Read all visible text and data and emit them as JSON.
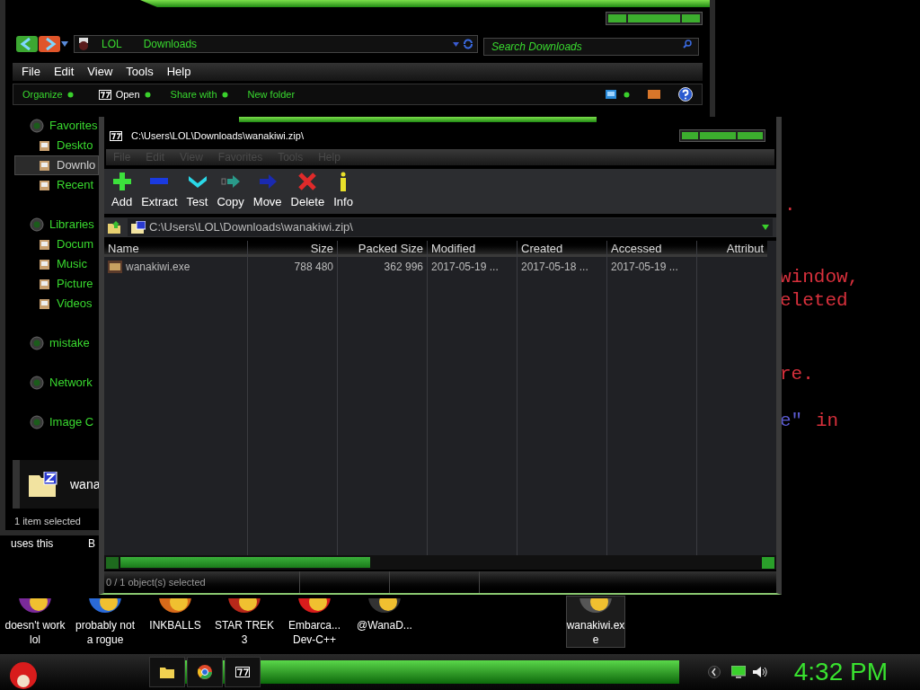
{
  "desktop_text": [
    {
      "text": ".",
      "color": "#d8303c"
    },
    {
      "text": "window,",
      "color": "#d8303c"
    },
    {
      "text": "eleted",
      "color": "#d8303c"
    },
    {
      "text": "re.",
      "color": "#d8303c"
    },
    {
      "text": "e\"",
      "color": "#5a5ad0"
    },
    {
      "text": "in",
      "color": "#d8303c"
    }
  ],
  "explorer": {
    "breadcrumb": [
      "LOL",
      "Downloads"
    ],
    "search": {
      "placeholder": "Search Downloads"
    },
    "menu": [
      "File",
      "Edit",
      "View",
      "Tools",
      "Help"
    ],
    "toolbar": [
      {
        "label": "Organize",
        "kind": "menu"
      },
      {
        "label": "Open",
        "kind": "open"
      },
      {
        "label": "Share with",
        "kind": "menu"
      },
      {
        "label": "New folder",
        "kind": "plain"
      }
    ],
    "sidebar": [
      {
        "label": "Favorites",
        "selected": false,
        "children": [
          {
            "label": "Deskto",
            "selected": false
          },
          {
            "label": "Downlo",
            "selected": true
          },
          {
            "label": "Recent",
            "selected": false
          }
        ]
      },
      {
        "label": "Libraries",
        "selected": false,
        "children": [
          {
            "label": "Docum",
            "selected": false
          },
          {
            "label": "Music",
            "selected": false
          },
          {
            "label": "Picture",
            "selected": false
          },
          {
            "label": "Videos",
            "selected": false
          }
        ]
      },
      {
        "label": "mistake",
        "selected": false
      },
      {
        "label": "Network",
        "selected": false
      },
      {
        "label": "Image C",
        "selected": false
      }
    ],
    "details": {
      "name": "wana"
    },
    "status": "1 item selected"
  },
  "hidden_labels": [
    "uses this",
    "B"
  ],
  "archive": {
    "title": "C:\\Users\\LOL\\Downloads\\wanakiwi.zip\\",
    "menu": [
      "File",
      "Edit",
      "View",
      "Favorites",
      "Tools",
      "Help"
    ],
    "toolbar": [
      {
        "label": "Add",
        "kind": "add"
      },
      {
        "label": "Extract",
        "kind": "extract"
      },
      {
        "label": "Test",
        "kind": "test"
      },
      {
        "label": "Copy",
        "kind": "copy"
      },
      {
        "label": "Move",
        "kind": "move"
      },
      {
        "label": "Delete",
        "kind": "delete"
      },
      {
        "label": "Info",
        "kind": "info"
      }
    ],
    "path": "C:\\Users\\LOL\\Downloads\\wanakiwi.zip\\",
    "table": {
      "columns": [
        "Name",
        "Size",
        "Packed Size",
        "Modified",
        "Created",
        "Accessed",
        "Attribut"
      ],
      "rows": [
        {
          "cells": [
            "wanakiwi.exe",
            "788 480",
            "362 996",
            "2017-05-19 ...",
            "2017-05-18 ...",
            "2017-05-19 ..."
          ]
        }
      ]
    },
    "status": "0 / 1 object(s) selected"
  },
  "desktop_icons": [
    {
      "lines": [
        "doesn't work",
        "lol"
      ],
      "selected": false
    },
    {
      "lines": [
        "probably not",
        "a rogue"
      ],
      "selected": false
    },
    {
      "lines": [
        "INKBALLS"
      ],
      "selected": false
    },
    {
      "lines": [
        "STAR TREK",
        "3"
      ],
      "selected": false
    },
    {
      "lines": [
        "Embarca...",
        "Dev-C++"
      ],
      "selected": false
    },
    {
      "lines": [
        "@WanaD..."
      ],
      "selected": false
    },
    {
      "lines": [
        "wanakiwi.ex",
        "e"
      ],
      "selected": true
    }
  ],
  "taskbar": {
    "buttons": [
      {
        "kind": "folder"
      },
      {
        "kind": "browser"
      },
      {
        "kind": "archive"
      }
    ],
    "clock": "4:32 PM"
  }
}
